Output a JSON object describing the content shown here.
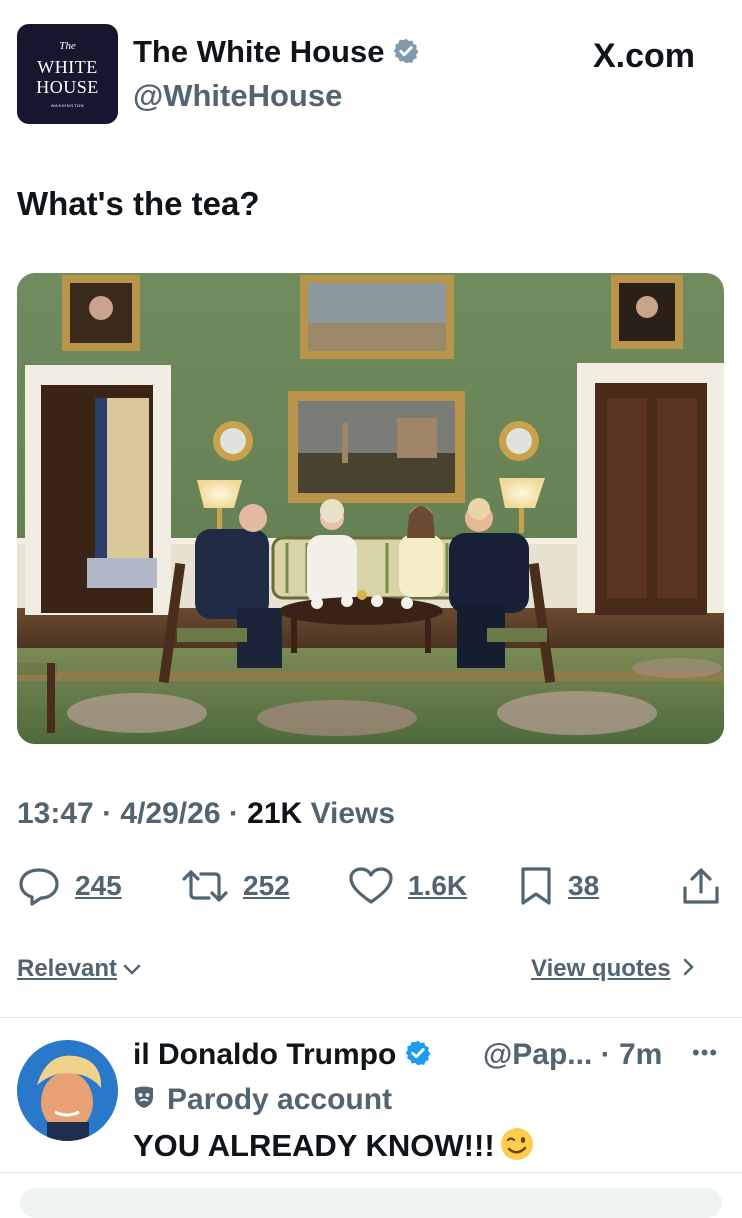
{
  "post": {
    "author_name": "The White House",
    "author_handle": "@WhiteHouse",
    "avatar_text": {
      "line1": "The",
      "line2": "WHITE",
      "line3": "HOUSE",
      "line4": "WASHINGTON"
    },
    "site": "X.com",
    "text": "What's the tea?",
    "time": "13:47",
    "date": "4/29/26",
    "views_count": "21K",
    "views_label": "Views"
  },
  "actions": {
    "replies": "245",
    "reposts": "252",
    "likes": "1.6K",
    "bookmarks": "38"
  },
  "sort": {
    "label": "Relevant",
    "quotes_label": "View quotes"
  },
  "reply": {
    "author_name": "il Donaldo Trumpo",
    "handle_time": "@Pap... · 7m",
    "badge": "Parody account",
    "text": "YOU ALREADY KNOW!!!"
  },
  "colors": {
    "verified": "#1d9bf0",
    "wall": "#6e8a5c",
    "secondary_text": "#536471"
  }
}
